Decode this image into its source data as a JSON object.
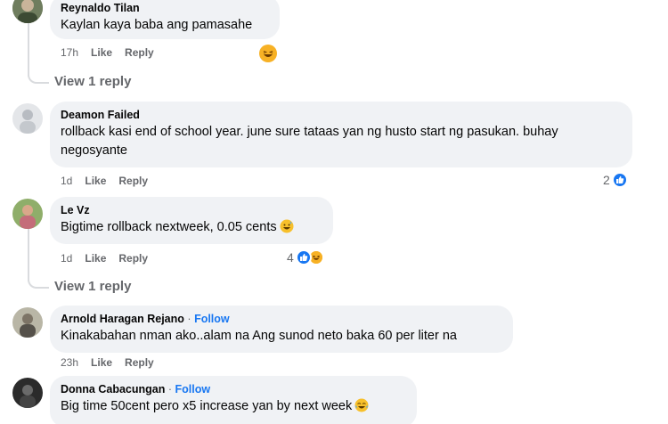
{
  "comments": [
    {
      "author": "Reynaldo Tilan",
      "text": "Kaylan kaya baba ang pamasahe",
      "time": "17h",
      "like_label": "Like",
      "reply_label": "Reply",
      "reactions": {
        "count": "",
        "icons": [
          "haha"
        ]
      },
      "view_replies": "View 1 reply"
    },
    {
      "author": "Deamon Failed",
      "text_line1": "rollback kasi end of school year. june sure tataas yan ng husto start ng pasukan. buhay",
      "text_line2": "negosyante",
      "time": "1d",
      "like_label": "Like",
      "reply_label": "Reply",
      "reactions": {
        "count": "2",
        "icons": [
          "like"
        ]
      }
    },
    {
      "author": "Le Vz",
      "text": "Bigtime rollback nextweek, 0.05 cents",
      "text_emoji": "grinning-sweat-emoji",
      "time": "1d",
      "like_label": "Like",
      "reply_label": "Reply",
      "reactions": {
        "count": "4",
        "icons": [
          "like",
          "haha"
        ]
      },
      "view_replies": "View 1 reply"
    },
    {
      "author": "Arnold Haragan Rejano",
      "follow_label": "Follow",
      "text": "Kinakabahan nman ako..alam na Ang sunod neto baka 60 per liter na",
      "time": "23h",
      "like_label": "Like",
      "reply_label": "Reply"
    },
    {
      "author": "Donna Cabacungan",
      "follow_label": "Follow",
      "text": "Big time 50cent pero x5 increase yan by next week",
      "text_emoji": "tears-of-joy-emoji"
    }
  ],
  "follow_separator": "·",
  "colors": {
    "bubble": "#f0f2f5",
    "meta": "#65676b",
    "link": "#1877f2",
    "like_reaction": "#1877f2",
    "haha_reaction": "#f7b125"
  }
}
